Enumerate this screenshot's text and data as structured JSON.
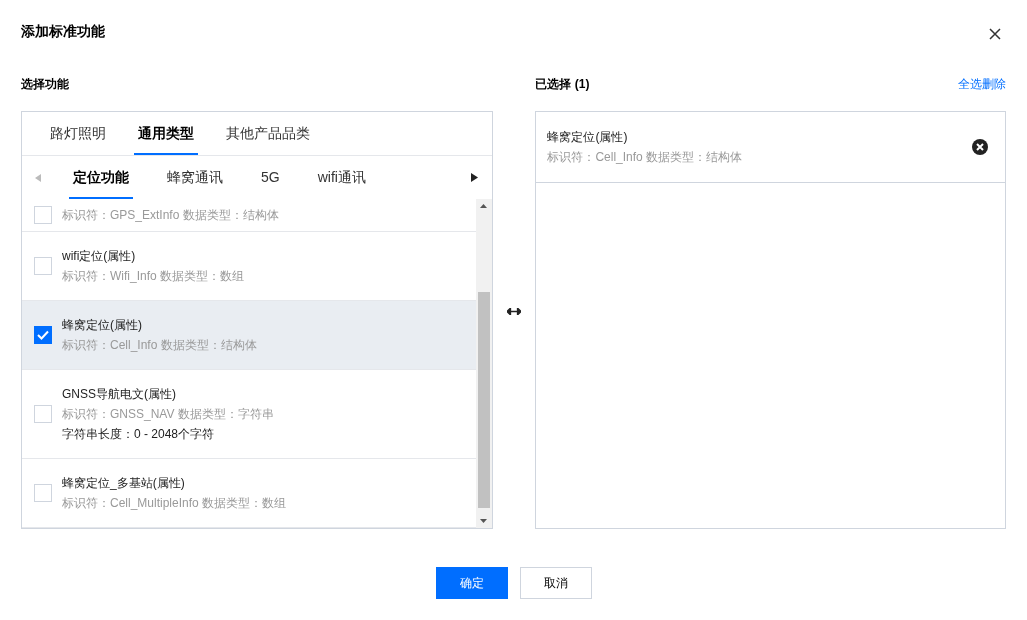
{
  "dialog": {
    "title": "添加标准功能"
  },
  "left": {
    "heading": "选择功能",
    "category_tabs": [
      {
        "label": "路灯照明",
        "selected": false
      },
      {
        "label": "通用类型",
        "selected": true
      },
      {
        "label": "其他产品品类",
        "selected": false
      }
    ],
    "sub_tabs": [
      {
        "label": "定位功能",
        "selected": true
      },
      {
        "label": "蜂窝通讯",
        "selected": false
      },
      {
        "label": "5G",
        "selected": false
      },
      {
        "label": "wifi通讯",
        "selected": false
      }
    ],
    "items": [
      {
        "detail": "标识符：GPS_ExtInfo 数据类型：结构体",
        "checked": false
      },
      {
        "title": "wifi定位(属性)",
        "detail": "标识符：Wifi_Info 数据类型：数组",
        "checked": false
      },
      {
        "title": "蜂窝定位(属性)",
        "detail": "标识符：Cell_Info 数据类型：结构体",
        "checked": true
      },
      {
        "title": "GNSS导航电文(属性)",
        "detail": "标识符：GNSS_NAV 数据类型：字符串",
        "extra": "字符串长度：0 - 2048个字符",
        "checked": false
      },
      {
        "title": "蜂窝定位_多基站(属性)",
        "detail": "标识符：Cell_MultipleInfo 数据类型：数组",
        "checked": false
      }
    ]
  },
  "right": {
    "heading": "已选择 (1)",
    "clear_link": "全选删除",
    "items": [
      {
        "title": "蜂窝定位(属性)",
        "detail": "标识符：Cell_Info 数据类型：结构体"
      }
    ]
  },
  "buttons": [
    {
      "label": "确定",
      "kind": "primary"
    },
    {
      "label": "取消",
      "kind": "secondary"
    }
  ]
}
